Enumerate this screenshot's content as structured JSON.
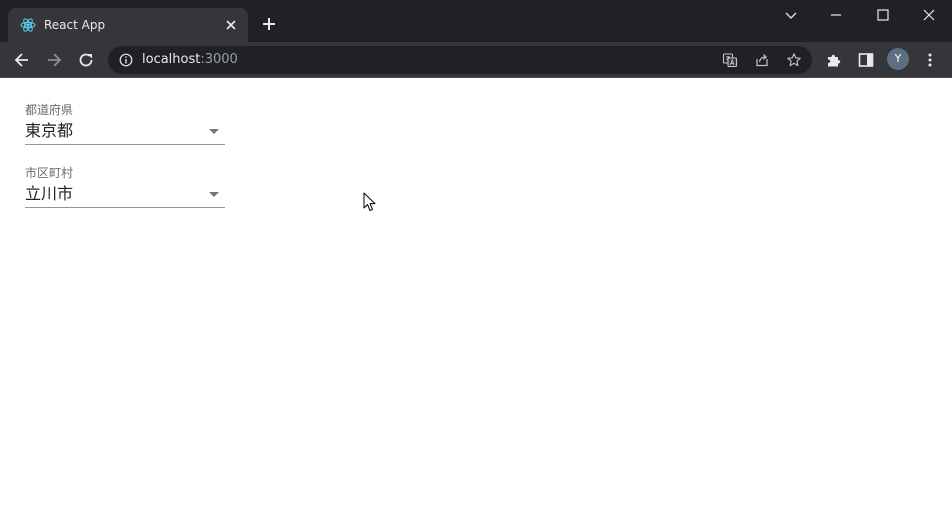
{
  "browser": {
    "tab": {
      "title": "React App",
      "favicon": "react-logo-icon"
    },
    "address": {
      "host": "localhost",
      "port": ":3000"
    },
    "avatar_letter": "Y",
    "colors": {
      "titlebar": "#202124",
      "toolbar": "#35363a",
      "omnibox": "#202124"
    }
  },
  "form": {
    "prefecture": {
      "label": "都道府県",
      "value": "東京都"
    },
    "city": {
      "label": "市区町村",
      "value": "立川市"
    }
  }
}
